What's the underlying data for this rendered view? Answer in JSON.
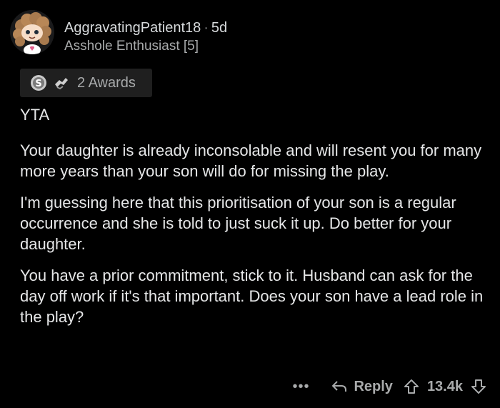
{
  "comment": {
    "username": "AggravatingPatient18",
    "separator": "·",
    "age": "5d",
    "flair": "Asshole Enthusiast [5]",
    "awards_label": "2 Awards",
    "paragraphs": [
      "YTA",
      "Your daughter is already inconsolable and will resent you for many more years than your son will do for missing the play.",
      "I'm guessing here that this prioritisation of your son is a regular occurrence and she is told to just suck it up. Do better for your daughter.",
      "You have a prior commitment, stick to it. Husband can ask for the day off work if it's that important. Does your son have a lead role in the play?"
    ],
    "more_label": "•••",
    "reply_label": "Reply",
    "score": "13.4k"
  },
  "icons": {
    "avatar": "snoo-avatar",
    "award_1": "silver-award-icon",
    "award_2": "wholesome-award-icon",
    "reply": "reply-arrow-icon",
    "upvote": "upvote-arrow-icon",
    "downvote": "downvote-arrow-icon"
  },
  "colors": {
    "background": "#000000",
    "text": "#e6e7e8",
    "muted": "#a8aaab",
    "award_bg": "#1f1f1f"
  }
}
